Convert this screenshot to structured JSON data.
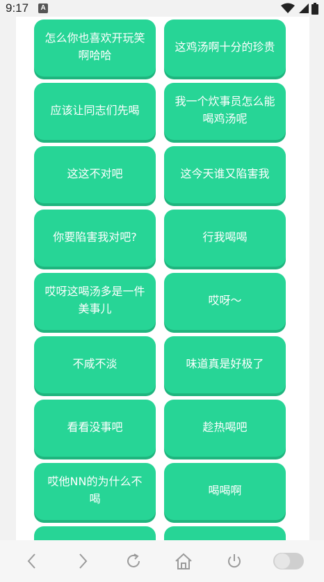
{
  "status_bar": {
    "time": "9:17",
    "notification_icon": "A",
    "icons": [
      "wifi-icon",
      "signal-icon",
      "battery-icon"
    ]
  },
  "phrases": [
    "怎么你也喜欢开玩笑啊哈哈",
    "这鸡汤啊十分的珍贵",
    "应该让同志们先喝",
    "我一个炊事员怎么能喝鸡汤呢",
    "这这不对吧",
    "这今天谁又陷害我",
    "你要陷害我对吧?",
    "行我喝喝",
    "哎呀这喝汤多是一件美事儿",
    "哎呀～",
    "不咸不淡",
    "味道真是好极了",
    "看看没事吧",
    "趁热喝吧",
    "哎他NN的为什么不喝",
    "喝喝啊",
    "",
    ""
  ],
  "nav": {
    "icons": [
      "back-icon",
      "forward-icon",
      "refresh-icon",
      "home-icon",
      "power-icon",
      "toggle-switch"
    ]
  },
  "colors": {
    "button": "#27d596",
    "button_shadow": "#1fb57e",
    "background": "#f2f2f2",
    "panel": "#ffffff"
  }
}
